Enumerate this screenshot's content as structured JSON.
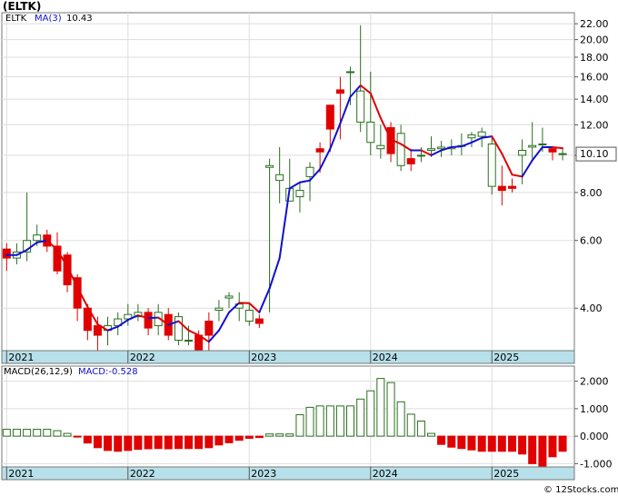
{
  "title": "(ELTK)",
  "watermark": "© 12Stocks.com",
  "price_legend": {
    "symbol": "ELTK",
    "ma_label": "MA(3)",
    "ma_value": "10.43"
  },
  "macd_legend": {
    "label": "MACD(26,12,9)",
    "value_label": "MACD:-0.528"
  },
  "last_price_tag": "10.10",
  "colors": {
    "up": "#2a6e1f",
    "down": "#e00000",
    "ma_up": "#1010d0",
    "ma_down": "#e00000",
    "axis_band": "#b7e0ea",
    "grid": "#dddddd"
  },
  "chart_data": [
    {
      "type": "candlestick",
      "title": "(ELTK)",
      "scale": "log",
      "ylim": [
        3.1,
        23.5
      ],
      "y_ticks": [
        "4.00",
        "6.00",
        "8.00",
        "10.00",
        "12.00",
        "14.00",
        "16.00",
        "18.00",
        "20.00",
        "22.00"
      ],
      "x_tick_labels": [
        "2021",
        "2022",
        "2023",
        "2024",
        "2025"
      ],
      "x_ticks": [
        2021.0,
        2022.0,
        2023.0,
        2024.0,
        2025.0
      ],
      "xlim": [
        2020.96,
        2025.68
      ],
      "grid": true,
      "series": [
        {
          "name": "ELTK",
          "x": [
            2021.0,
            2021.083,
            2021.167,
            2021.25,
            2021.333,
            2021.417,
            2021.5,
            2021.583,
            2021.667,
            2021.75,
            2021.833,
            2021.917,
            2022.0,
            2022.083,
            2022.167,
            2022.25,
            2022.333,
            2022.417,
            2022.5,
            2022.583,
            2022.667,
            2022.75,
            2022.833,
            2022.917,
            2023.0,
            2023.083,
            2023.167,
            2023.25,
            2023.333,
            2023.417,
            2023.5,
            2023.583,
            2023.667,
            2023.75,
            2023.833,
            2023.917,
            2024.0,
            2024.083,
            2024.167,
            2024.25,
            2024.333,
            2024.417,
            2024.5,
            2024.583,
            2024.667,
            2024.75,
            2024.833,
            2024.917,
            2025.0,
            2025.083,
            2025.167,
            2025.25,
            2025.333,
            2025.417,
            2025.5,
            2025.583
          ],
          "open": [
            5.7,
            5.4,
            5.6,
            6.0,
            6.2,
            5.8,
            5.5,
            4.8,
            4.0,
            3.6,
            3.5,
            3.6,
            3.75,
            3.8,
            3.9,
            3.6,
            3.85,
            3.3,
            3.3,
            3.4,
            3.7,
            3.95,
            4.25,
            4.0,
            3.7,
            3.75,
            9.3,
            8.6,
            7.6,
            7.8,
            8.8,
            10.4,
            13.5,
            14.8,
            16.5,
            12.2,
            10.8,
            10.4,
            11.8,
            9.4,
            9.8,
            10.0,
            10.3,
            10.4,
            10.4,
            10.6,
            11.1,
            11.2,
            8.3,
            8.3,
            8.3,
            10.0,
            10.5,
            10.7,
            10.4,
            10.1
          ],
          "close": [
            5.4,
            5.6,
            6.0,
            6.2,
            5.8,
            5.0,
            4.6,
            4.0,
            3.5,
            3.4,
            3.6,
            3.75,
            3.85,
            3.9,
            3.55,
            3.9,
            3.4,
            3.8,
            3.3,
            3.1,
            3.4,
            4.0,
            4.3,
            4.1,
            3.95,
            3.65,
            9.4,
            8.9,
            8.2,
            8.1,
            9.3,
            10.2,
            11.7,
            14.5,
            16.5,
            14.7,
            12.2,
            10.6,
            10.1,
            11.4,
            9.5,
            10.0,
            10.4,
            10.5,
            10.5,
            10.6,
            11.3,
            11.5,
            10.7,
            8.1,
            8.2,
            10.3,
            10.6,
            10.7,
            10.2,
            10.1
          ],
          "high": [
            5.9,
            5.9,
            8.0,
            6.6,
            6.4,
            6.3,
            5.6,
            4.9,
            4.1,
            3.8,
            3.8,
            3.9,
            4.1,
            4.1,
            4.0,
            4.1,
            4.0,
            3.9,
            3.6,
            3.5,
            3.9,
            4.2,
            4.4,
            4.4,
            4.1,
            3.85,
            9.8,
            10.5,
            9.8,
            8.5,
            9.6,
            10.8,
            12.0,
            16.0,
            17.0,
            21.8,
            16.5,
            12.0,
            12.2,
            12.0,
            10.4,
            10.5,
            11.2,
            10.9,
            11.0,
            11.4,
            11.5,
            11.8,
            11.2,
            9.4,
            8.7,
            11.0,
            12.2,
            11.8,
            10.5,
            10.4
          ],
          "low": [
            5.0,
            5.2,
            5.3,
            5.8,
            5.6,
            4.9,
            4.4,
            3.7,
            3.3,
            3.1,
            3.2,
            3.4,
            3.6,
            3.7,
            3.4,
            3.4,
            3.3,
            3.2,
            3.2,
            3.0,
            3.1,
            3.7,
            4.0,
            3.7,
            3.6,
            3.55,
            3.9,
            7.5,
            7.6,
            7.1,
            7.6,
            9.0,
            10.2,
            11.0,
            13.5,
            11.5,
            10.0,
            9.8,
            9.6,
            9.1,
            9.1,
            9.6,
            9.9,
            9.9,
            10.0,
            10.0,
            10.5,
            10.5,
            7.9,
            7.4,
            8.0,
            8.4,
            9.8,
            10.2,
            9.7,
            9.7
          ]
        },
        {
          "name": "MA(3)",
          "x": [
            2021.0,
            2021.083,
            2021.167,
            2021.25,
            2021.333,
            2021.417,
            2021.5,
            2021.583,
            2021.667,
            2021.75,
            2021.833,
            2021.917,
            2022.0,
            2022.083,
            2022.167,
            2022.25,
            2022.333,
            2022.417,
            2022.5,
            2022.583,
            2022.667,
            2022.75,
            2022.833,
            2022.917,
            2023.0,
            2023.083,
            2023.167,
            2023.25,
            2023.333,
            2023.417,
            2023.5,
            2023.583,
            2023.667,
            2023.75,
            2023.833,
            2023.917,
            2024.0,
            2024.083,
            2024.167,
            2024.25,
            2024.333,
            2024.417,
            2024.5,
            2024.583,
            2024.667,
            2024.75,
            2024.833,
            2024.917,
            2025.0,
            2025.083,
            2025.167,
            2025.25,
            2025.333,
            2025.417,
            2025.5,
            2025.583
          ],
          "values": [
            5.5,
            5.5,
            5.67,
            5.93,
            6.0,
            5.67,
            5.13,
            4.53,
            4.03,
            3.63,
            3.5,
            3.58,
            3.73,
            3.83,
            3.77,
            3.78,
            3.62,
            3.7,
            3.5,
            3.4,
            3.27,
            3.5,
            3.9,
            4.13,
            4.12,
            3.9,
            4.5,
            5.4,
            8.2,
            8.5,
            8.6,
            9.2,
            10.4,
            12.1,
            14.2,
            15.2,
            14.5,
            12.5,
            11.0,
            10.7,
            10.3,
            10.3,
            10.0,
            10.3,
            10.5,
            10.55,
            10.8,
            11.1,
            11.2,
            10.1,
            8.9,
            8.8,
            9.7,
            10.5,
            10.5,
            10.43
          ]
        }
      ]
    },
    {
      "type": "bar",
      "title": "MACD(26,12,9)",
      "ylim": [
        -1.12,
        2.55
      ],
      "y_ticks": [
        "2.000",
        "1.000",
        "0.000",
        "-1.000"
      ],
      "x_tick_labels": [
        "2021",
        "2022",
        "2023",
        "2024",
        "2025"
      ],
      "x_ticks": [
        2021.0,
        2022.0,
        2023.0,
        2024.0,
        2025.0
      ],
      "xlim": [
        2020.96,
        2025.68
      ],
      "grid": true,
      "series": [
        {
          "name": "MACD",
          "x": [
            2021.0,
            2021.083,
            2021.167,
            2021.25,
            2021.333,
            2021.417,
            2021.5,
            2021.583,
            2021.667,
            2021.75,
            2021.833,
            2021.917,
            2022.0,
            2022.083,
            2022.167,
            2022.25,
            2022.333,
            2022.417,
            2022.5,
            2022.583,
            2022.667,
            2022.75,
            2022.833,
            2022.917,
            2023.0,
            2023.083,
            2023.167,
            2023.25,
            2023.333,
            2023.417,
            2023.5,
            2023.583,
            2023.667,
            2023.75,
            2023.833,
            2023.917,
            2024.0,
            2024.083,
            2024.167,
            2024.25,
            2024.333,
            2024.417,
            2024.5,
            2024.583,
            2024.667,
            2024.75,
            2024.833,
            2024.917,
            2025.0,
            2025.083,
            2025.167,
            2025.25,
            2025.333,
            2025.417,
            2025.5,
            2025.583
          ],
          "values": [
            0.25,
            0.25,
            0.25,
            0.25,
            0.25,
            0.2,
            0.1,
            -0.03,
            -0.25,
            -0.42,
            -0.52,
            -0.55,
            -0.52,
            -0.48,
            -0.46,
            -0.45,
            -0.46,
            -0.45,
            -0.45,
            -0.45,
            -0.42,
            -0.32,
            -0.24,
            -0.15,
            -0.08,
            -0.05,
            0.08,
            0.08,
            0.08,
            0.78,
            1.05,
            1.1,
            1.1,
            1.1,
            1.1,
            1.35,
            1.65,
            2.1,
            1.95,
            1.25,
            0.8,
            0.55,
            0.1,
            -0.3,
            -0.4,
            -0.45,
            -0.5,
            -0.55,
            -0.55,
            -0.55,
            -0.55,
            -0.65,
            -1.0,
            -1.1,
            -0.75,
            -0.55
          ]
        }
      ]
    }
  ]
}
